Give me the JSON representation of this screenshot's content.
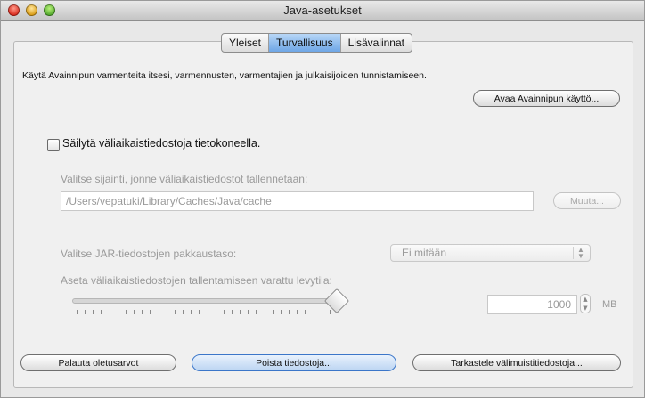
{
  "window": {
    "title": "Java-asetukset"
  },
  "tabs": [
    {
      "label": "Yleiset",
      "active": false
    },
    {
      "label": "Turvallisuus",
      "active": true
    },
    {
      "label": "Lisävalinnat",
      "active": false
    }
  ],
  "security": {
    "description": "Käytä Avainnipun varmenteita itsesi, varmennusten, varmentajien ja julkaisijoiden tunnistamiseen.",
    "open_keychain_label": "Avaa Avainnipun käyttö..."
  },
  "cache": {
    "keep_temp_files_label": "Säilytä väliaikaistiedostoja tietokoneella.",
    "keep_temp_files_checked": false,
    "location_prompt": "Valitse sijainti, jonne väliaikaistiedostot tallennetaan:",
    "location_value": "/Users/vepatuki/Library/Caches/Java/cache",
    "change_label": "Muuta...",
    "compression_label": "Valitse JAR-tiedostojen pakkaustaso:",
    "compression_value": "Ei mitään",
    "disk_space_label": "Aseta väliaikaistiedostojen tallentamiseen varattu levytila:",
    "disk_space_value": "1000",
    "disk_space_unit": "MB",
    "slider_level": 1.0
  },
  "footer": {
    "restore_defaults_label": "Palauta oletusarvot",
    "delete_files_label": "Poista tiedostoja...",
    "view_cache_label": "Tarkastele välimuistitiedostoja..."
  },
  "colors": {
    "active_tab": "#6ea6e6",
    "default_button_border": "#3b76c9",
    "disabled_text": "#9a9a9a"
  }
}
